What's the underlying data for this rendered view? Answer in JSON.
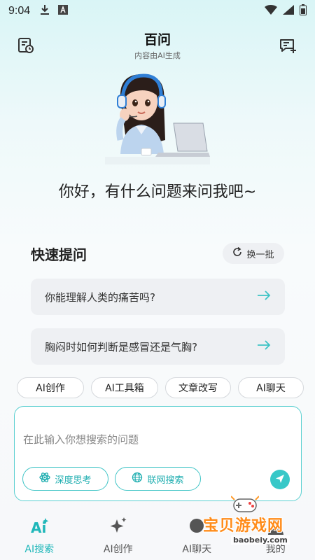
{
  "status": {
    "time": "9:04",
    "icons": [
      "download-icon",
      "app-a-icon",
      "wifi-icon",
      "signal-icon",
      "battery-icon"
    ]
  },
  "header": {
    "title": "百问",
    "subtitle": "内容由AI生成",
    "history_icon": "history-icon",
    "new_chat_icon": "new-chat-icon"
  },
  "greeting": "你好，有什么问题来问我吧~",
  "quick": {
    "title": "快速提问",
    "refresh_label": "换一批",
    "questions": [
      "你能理解人类的痛苦吗?",
      "胸闷时如何判断是感冒还是气胸?"
    ]
  },
  "chips": [
    "AI创作",
    "AI工具箱",
    "文章改写",
    "AI聊天"
  ],
  "composer": {
    "placeholder": "在此输入你想搜索的问题",
    "value": "",
    "deep_think_label": "深度思考",
    "web_search_label": "联网搜索"
  },
  "nav": [
    {
      "label": "AI搜索",
      "icon": "ai-search-icon",
      "active": true
    },
    {
      "label": "AI创作",
      "icon": "sparkle-icon",
      "active": false
    },
    {
      "label": "AI聊天",
      "icon": "chat-icon",
      "active": false
    },
    {
      "label": "我的",
      "icon": "profile-icon",
      "active": false
    }
  ],
  "watermark": {
    "text": "宝贝游戏网",
    "url": "baobeiy.com"
  },
  "colors": {
    "accent": "#37c8c8",
    "accent_text": "#1fb7b9",
    "card_bg": "#eef0f3",
    "watermark": "#ff8c1a"
  }
}
